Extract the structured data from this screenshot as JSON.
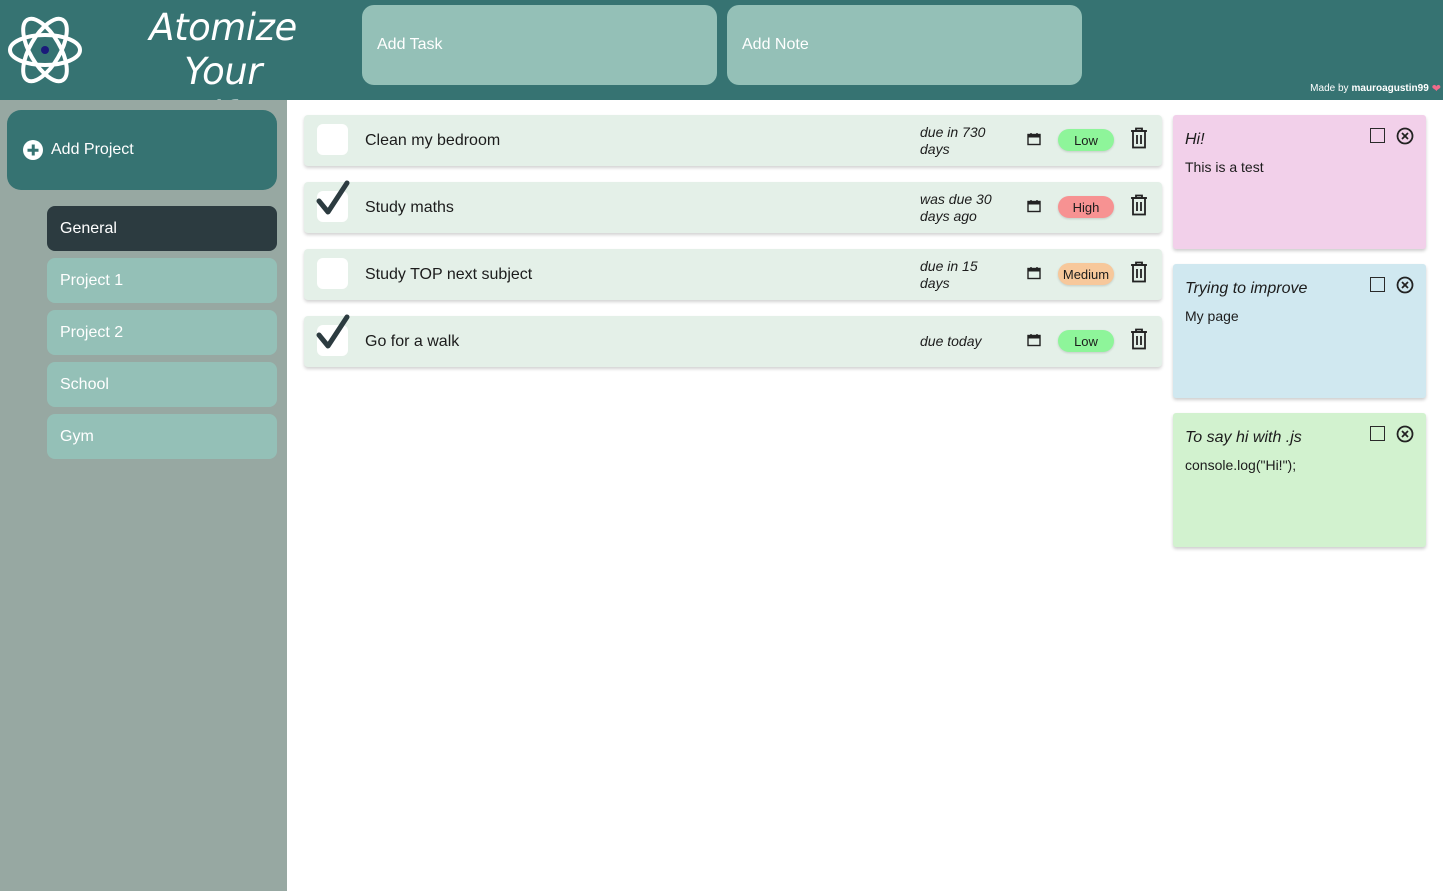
{
  "header": {
    "title_line1": "Atomize Your",
    "title_line2": "Life",
    "add_task_label": "Add Task",
    "add_note_label": "Add Note",
    "credit_prefix": "Made by",
    "credit_author": "mauroagustin99",
    "credit_icon": "heart-icon"
  },
  "sidebar": {
    "add_project_label": "Add Project",
    "projects": [
      {
        "label": "General",
        "active": true
      },
      {
        "label": "Project 1",
        "active": false
      },
      {
        "label": "Project 2",
        "active": false
      },
      {
        "label": "School",
        "active": false
      },
      {
        "label": "Gym",
        "active": false
      }
    ]
  },
  "tasks": [
    {
      "title": "Clean my bedroom",
      "done": false,
      "due": "due in 730 days",
      "priority": "Low"
    },
    {
      "title": "Study maths",
      "done": true,
      "due": "was due 30 days ago",
      "priority": "High"
    },
    {
      "title": "Study TOP next subject",
      "done": false,
      "due": "due in 15 days",
      "priority": "Medium"
    },
    {
      "title": "Go for a walk",
      "done": true,
      "due": "due today",
      "priority": "Low"
    }
  ],
  "notes": [
    {
      "title": "Hi!",
      "body": "This is a test",
      "color": "#f2d0ea"
    },
    {
      "title": "Trying to improve",
      "body": "My page",
      "color": "#d0e8f0"
    },
    {
      "title": "To say hi with .js",
      "body": "console.log(\"Hi!\");",
      "color": "#d2f2cf"
    }
  ],
  "colors": {
    "header_bg": "#367372",
    "button_bg": "#94c0b7",
    "sidebar_bg": "#97a8a2",
    "active_project_bg": "#2c3b40",
    "task_bg": "#e4f0e8",
    "priority_low": "#8ef59a",
    "priority_high": "#f79292",
    "priority_medium": "#f7c89b"
  }
}
